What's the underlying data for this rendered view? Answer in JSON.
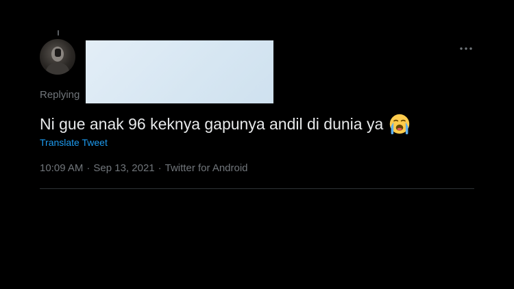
{
  "tweet": {
    "replying_label": "Replying",
    "text": "Ni gue anak 96 keknya gapunya andil di dunia ya",
    "emoji_icon": "loudly-crying-face-icon",
    "translate_label": "Translate Tweet",
    "time": "10:09 AM",
    "separator": "·",
    "date": "Sep 13, 2021",
    "source": "Twitter for Android"
  },
  "colors": {
    "background": "#000000",
    "text": "#e7e9ea",
    "muted": "#71767b",
    "link": "#1d9bf0",
    "divider": "#2f3336"
  }
}
